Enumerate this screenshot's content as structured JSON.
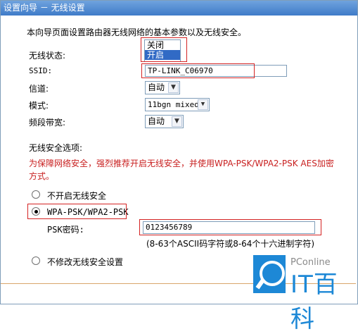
{
  "title": "设置向导 － 无线设置",
  "intro": "本向导页面设置路由器无线网络的基本参数以及无线安全。",
  "status": {
    "label": "无线状态:",
    "options": [
      "关闭",
      "开启"
    ],
    "selected": "开启"
  },
  "ssid": {
    "label": "SSID:",
    "value": "TP-LINK_C06970"
  },
  "channel": {
    "label": "信道:",
    "value": "自动"
  },
  "mode": {
    "label": "模式:",
    "value": "11bgn mixed"
  },
  "bandwidth": {
    "label": "频段带宽:",
    "value": "自动"
  },
  "security": {
    "label": "无线安全选项:",
    "warning": "为保障网络安全，强烈推荐开启无线安全，并使用WPA-PSK/WPA2-PSK AES加密方式。",
    "options": [
      {
        "label": "不开启无线安全",
        "checked": false
      },
      {
        "label": "WPA-PSK/WPA2-PSK",
        "checked": true
      },
      {
        "label": "不修改无线安全设置",
        "checked": false
      }
    ],
    "psk_label": "PSK密码:",
    "psk_value": "0123456789",
    "psk_hint": "(8-63个ASCII码字符或8-64个十六进制字符)"
  },
  "watermark": {
    "small": "PConline",
    "big": "IT百科"
  },
  "colors": {
    "highlight": "#d42323",
    "warning": "#c81e1e",
    "titlebar": "#3f7bc9",
    "logo": "#1d88d6"
  }
}
